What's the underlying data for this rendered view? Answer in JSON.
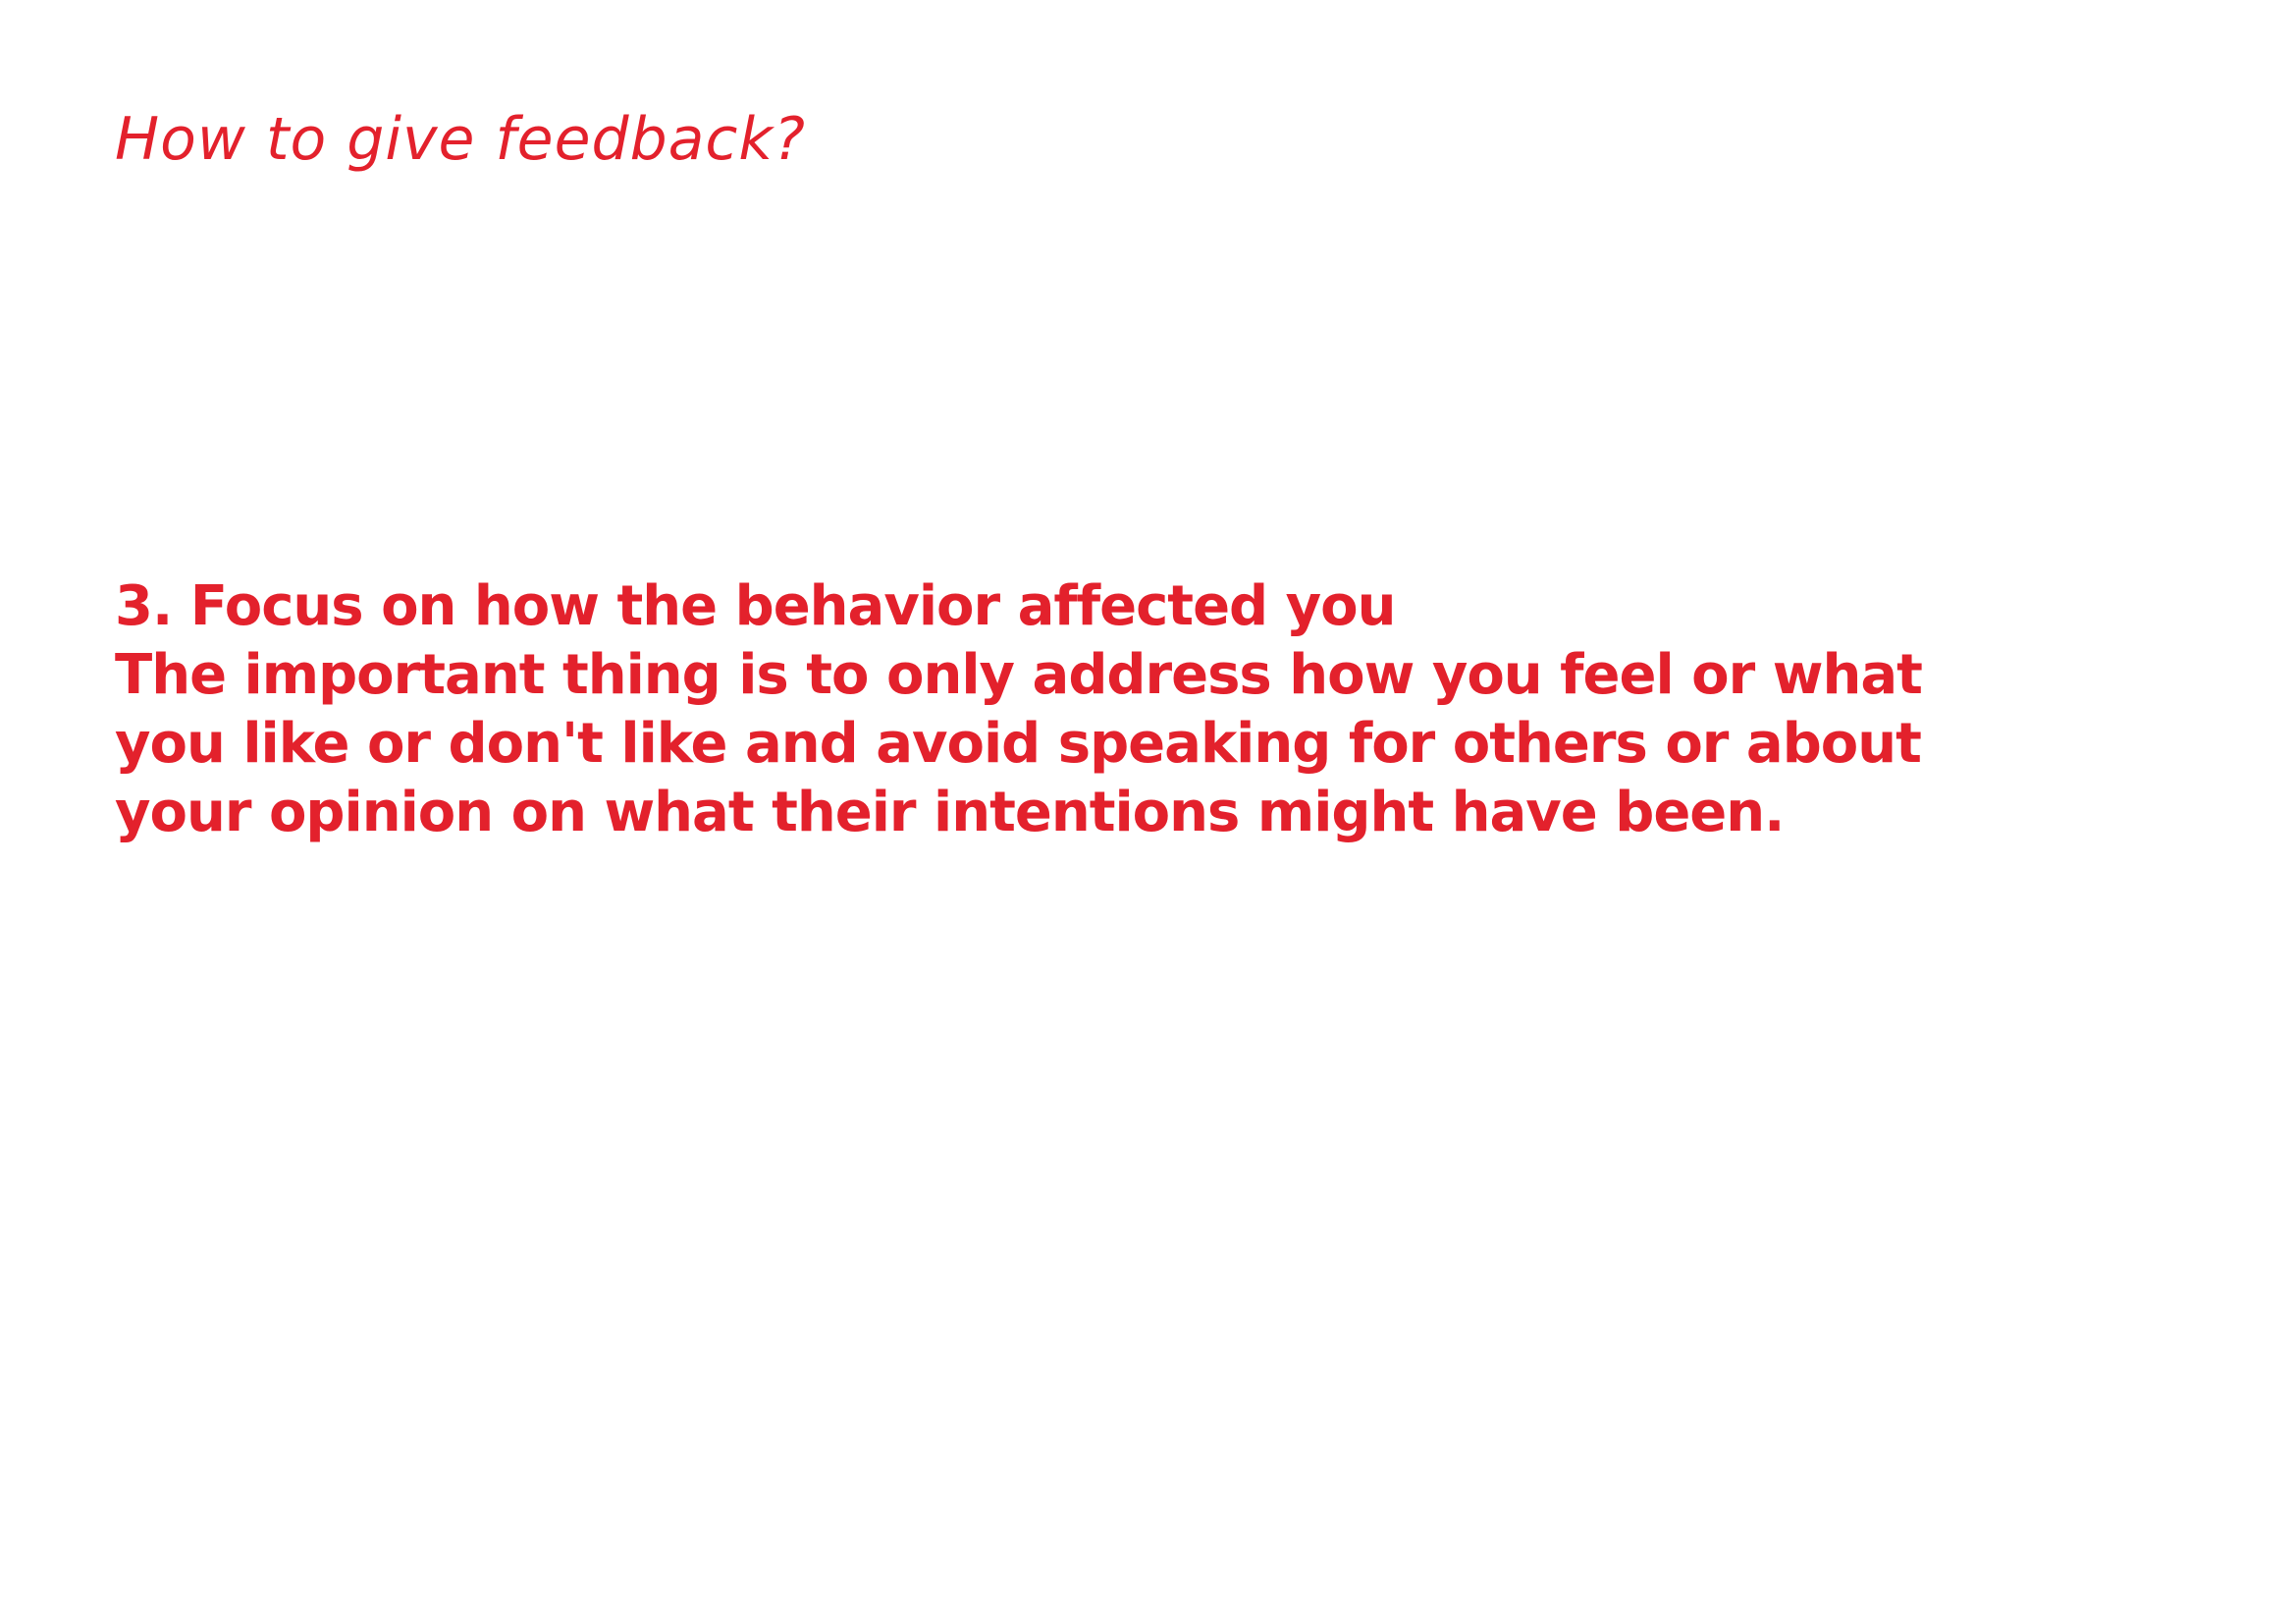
{
  "colors": {
    "text": "#e3212c",
    "background": "#ffffff"
  },
  "page": {
    "title": "How to give feedback?",
    "heading": "3. Focus on how the behavior affected you",
    "body_lines": [
      "The important thing is to only address how you feel or what",
      "you like or don't like and avoid speaking for others or about",
      "your opinion on what their intentions might have been."
    ]
  }
}
